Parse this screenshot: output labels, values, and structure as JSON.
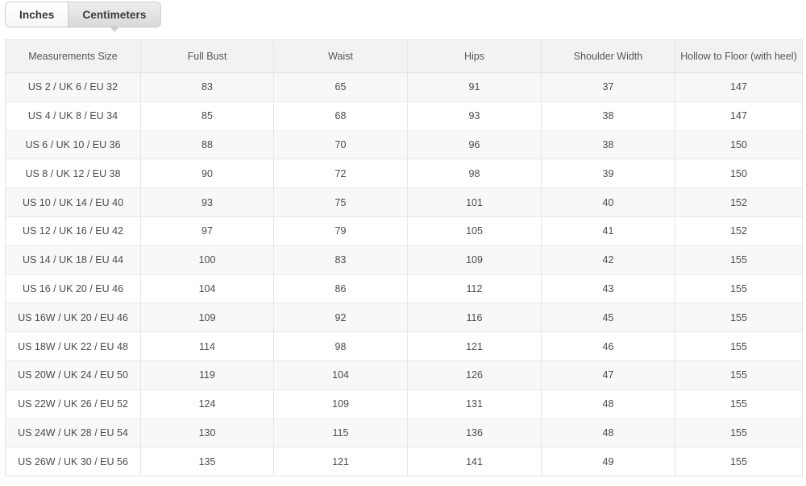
{
  "tabs": [
    {
      "label": "Inches",
      "active": false
    },
    {
      "label": "Centimeters",
      "active": true
    }
  ],
  "table": {
    "headers": [
      "Measurements Size",
      "Full Bust",
      "Waist",
      "Hips",
      "Shoulder Width",
      "Hollow to Floor (with heel)"
    ],
    "rows": [
      [
        "US 2 / UK 6 / EU 32",
        "83",
        "65",
        "91",
        "37",
        "147"
      ],
      [
        "US 4 / UK 8 / EU 34",
        "85",
        "68",
        "93",
        "38",
        "147"
      ],
      [
        "US 6 / UK 10 / EU 36",
        "88",
        "70",
        "96",
        "38",
        "150"
      ],
      [
        "US 8 / UK 12 / EU 38",
        "90",
        "72",
        "98",
        "39",
        "150"
      ],
      [
        "US 10 / UK 14 / EU 40",
        "93",
        "75",
        "101",
        "40",
        "152"
      ],
      [
        "US 12 / UK 16 / EU 42",
        "97",
        "79",
        "105",
        "41",
        "152"
      ],
      [
        "US 14 / UK 18 / EU 44",
        "100",
        "83",
        "109",
        "42",
        "155"
      ],
      [
        "US 16 / UK 20 / EU 46",
        "104",
        "86",
        "112",
        "43",
        "155"
      ],
      [
        "US 16W / UK 20 / EU 46",
        "109",
        "92",
        "116",
        "45",
        "155"
      ],
      [
        "US 18W / UK 22 / EU 48",
        "114",
        "98",
        "121",
        "46",
        "155"
      ],
      [
        "US 20W / UK 24 / EU 50",
        "119",
        "104",
        "126",
        "47",
        "155"
      ],
      [
        "US 22W / UK 26 / EU 52",
        "124",
        "109",
        "131",
        "48",
        "155"
      ],
      [
        "US 24W / UK 28 / EU 54",
        "130",
        "115",
        "136",
        "48",
        "155"
      ],
      [
        "US 26W / UK 30 / EU 56",
        "135",
        "121",
        "141",
        "49",
        "155"
      ]
    ]
  },
  "colors": {
    "header_bg": "#f2f2f2",
    "row_odd_bg": "#f8f8f8",
    "row_even_bg": "#ffffff",
    "border": "#e6e6e6",
    "text": "#4b4b4b",
    "tab_active_bg": "#d9d9d9"
  }
}
